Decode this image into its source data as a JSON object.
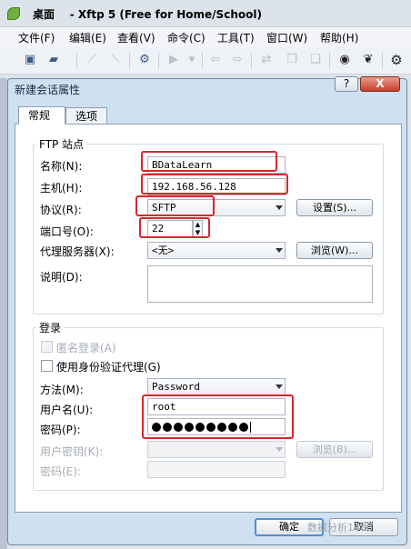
{
  "window": {
    "prefix": "桌面",
    "title": "- Xftp 5 (Free for Home/School)"
  },
  "menu": [
    "文件(F)",
    "编辑(E)",
    "查看(V)",
    "命令(C)",
    "工具(T)",
    "窗口(W)",
    "帮助(H)"
  ],
  "toolbar_icons": [
    "new-session-icon",
    "open-folder-icon",
    "connect-icon",
    "disconnect-icon",
    "properties-icon",
    "play-icon",
    "back-icon",
    "forward-icon",
    "transfer-icon",
    "copy-icon",
    "paste-icon",
    "theme-icon",
    "leaf-icon",
    "settings-icon"
  ],
  "dialog": {
    "title": "新建会话属性",
    "help": "?",
    "close": "X",
    "tabs": [
      "常规",
      "选项"
    ],
    "ftp_group": "FTP 站点",
    "name_label": "名称(N):",
    "name_value": "BDataLearn",
    "host_label": "主机(H):",
    "host_value": "192.168.56.128",
    "protocol_label": "协议(R):",
    "protocol_value": "SFTP",
    "settings_button": "设置(S)...",
    "port_label": "端口号(O):",
    "port_value": "22",
    "proxy_label": "代理服务器(X):",
    "proxy_value": "<无>",
    "browse_button": "浏览(W)...",
    "desc_label": "说明(D):",
    "login_group": "登录",
    "anonymous_label": "匿名登录(A)",
    "auth_agent_label": "使用身份验证代理(G)",
    "method_label": "方法(M):",
    "method_value": "Password",
    "user_label": "用户名(U):",
    "user_value": "root",
    "pass_label": "密码(P):",
    "userkey_label": "用户密钥(K):",
    "userkey_browse": "浏览(B)...",
    "passphrase_label": "密码(E):",
    "ok_button": "确定",
    "cancel_button": "取消"
  },
  "watermark": "数据分析1480"
}
